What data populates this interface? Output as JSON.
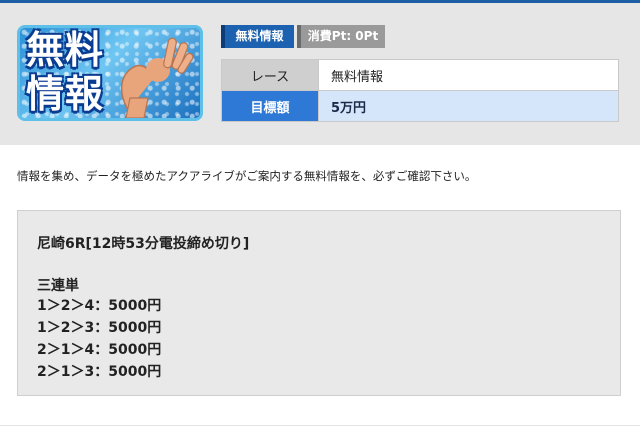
{
  "thumbnail": {
    "text_line1": "無料",
    "text_line2": "情報",
    "icon": "ok-hand-icon"
  },
  "badges": {
    "free_label": "無料情報",
    "points_label": "消費Pt: 0Pt"
  },
  "info_table": {
    "rows": [
      {
        "label": "レース",
        "value": "無料情報"
      },
      {
        "label": "目標額",
        "value": "5万円"
      }
    ]
  },
  "intro_text": "情報を集め、データを極めたアクアライブがご案内する無料情報を、必ずご確認下さい。",
  "content": {
    "race_title": "尼崎6R[12時53分電投締め切り]",
    "bet_type": "三連単",
    "bets": [
      "1＞2＞4：5000円",
      "1＞2＞3：5000円",
      "2＞1＞4：5000円",
      "2＞1＞3：5000円"
    ]
  },
  "colors": {
    "accent_blue": "#1c62b0",
    "target_label_bg": "#2f79d6",
    "target_value_bg": "#d6e6fa",
    "header_bg": "#e6e6e6"
  }
}
